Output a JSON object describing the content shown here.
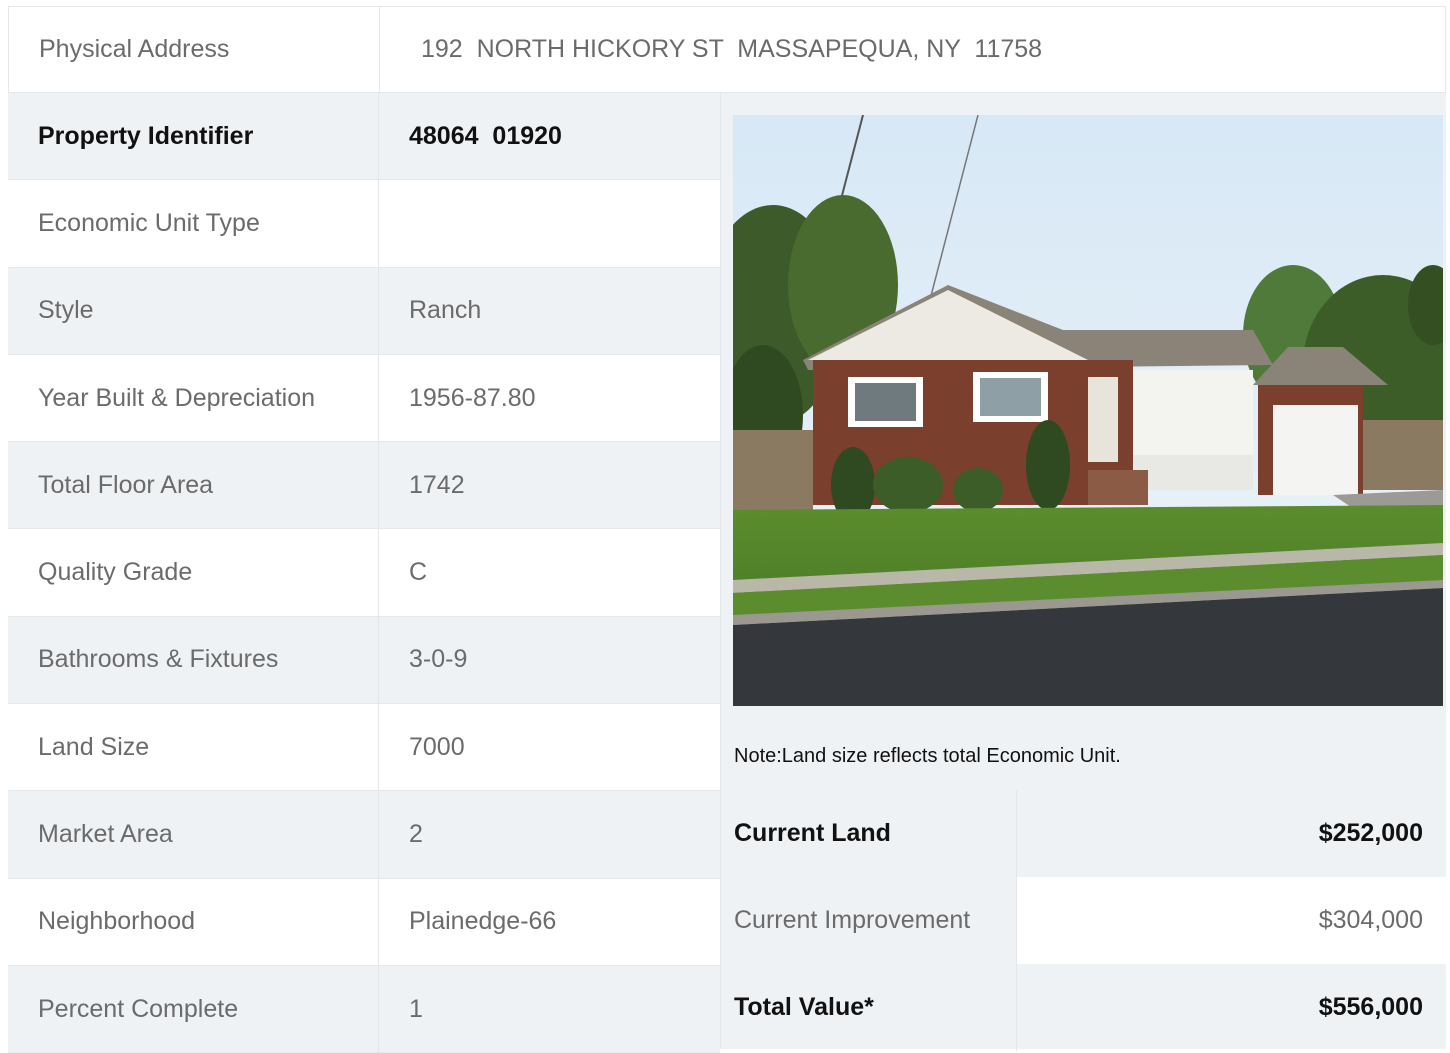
{
  "address": {
    "label": "Physical Address",
    "value": "192  NORTH HICKORY ST  MASSAPEQUA, NY  11758"
  },
  "details": [
    {
      "label": "Property Identifier",
      "value": "48064  01920"
    },
    {
      "label": "Economic Unit Type",
      "value": ""
    },
    {
      "label": "Style",
      "value": "Ranch"
    },
    {
      "label": "Year Built & Depreciation",
      "value": "1956-87.80"
    },
    {
      "label": "Total Floor Area",
      "value": "1742"
    },
    {
      "label": "Quality Grade",
      "value": "C"
    },
    {
      "label": "Bathrooms & Fixtures",
      "value": "3-0-9"
    },
    {
      "label": "Land Size",
      "value": "7000"
    },
    {
      "label": "Market Area",
      "value": "2"
    },
    {
      "label": "Neighborhood",
      "value": "Plainedge-66"
    },
    {
      "label": "Percent Complete",
      "value": "1"
    }
  ],
  "note": "Note:Land size reflects total Economic Unit.",
  "values": [
    {
      "label": "Current Land",
      "value": "$252,000"
    },
    {
      "label": "Current Improvement",
      "value": "$304,000"
    },
    {
      "label": "Total Value*",
      "value": "$556,000"
    }
  ]
}
